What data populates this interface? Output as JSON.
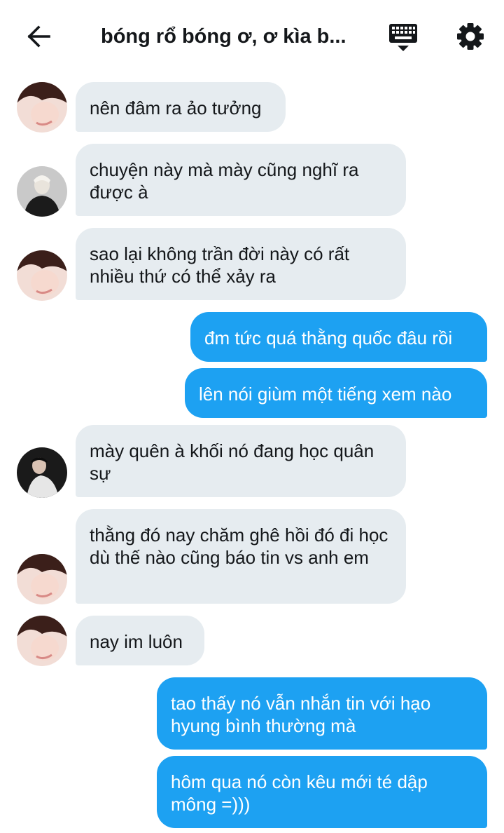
{
  "header": {
    "title": "bóng rổ bóng ơ, ơ kìa b...",
    "back_icon": "arrow-left-icon",
    "keyboard_icon": "keyboard-icon",
    "settings_icon": "gear-icon"
  },
  "colors": {
    "incoming_bubble": "#e6ecf0",
    "outgoing_bubble": "#1da1f2",
    "outgoing_text": "#ffffff",
    "incoming_text": "#14171a"
  },
  "messages": [
    {
      "direction": "in",
      "sender_avatar": "avatar-a",
      "text": "nên đâm ra ảo tưởng"
    },
    {
      "direction": "in",
      "sender_avatar": "avatar-b",
      "text": "chuyện này mà mày cũng nghĩ ra được à"
    },
    {
      "direction": "in",
      "sender_avatar": "avatar-a",
      "text": "sao lại không trần đời này có rất nhiều thứ có thể xảy ra"
    },
    {
      "direction": "out",
      "text": "đm tức quá thằng quốc đâu rồi"
    },
    {
      "direction": "out",
      "text": "lên nói giùm một tiếng xem nào"
    },
    {
      "direction": "in",
      "sender_avatar": "avatar-c",
      "text": "mày quên à khối nó đang học quân sự"
    },
    {
      "direction": "in",
      "sender_avatar": "avatar-a",
      "text": "thằng đó nay chăm ghê hồi đó đi học dù thế nào cũng báo tin vs anh em"
    },
    {
      "direction": "in",
      "sender_avatar": "avatar-a",
      "text": "nay im luôn"
    },
    {
      "direction": "out",
      "text": "tao thấy nó vẫn nhắn tin với hạo hyung bình thường mà"
    },
    {
      "direction": "out",
      "text": "hôm qua nó còn kêu mới té dập mông =)))"
    }
  ]
}
